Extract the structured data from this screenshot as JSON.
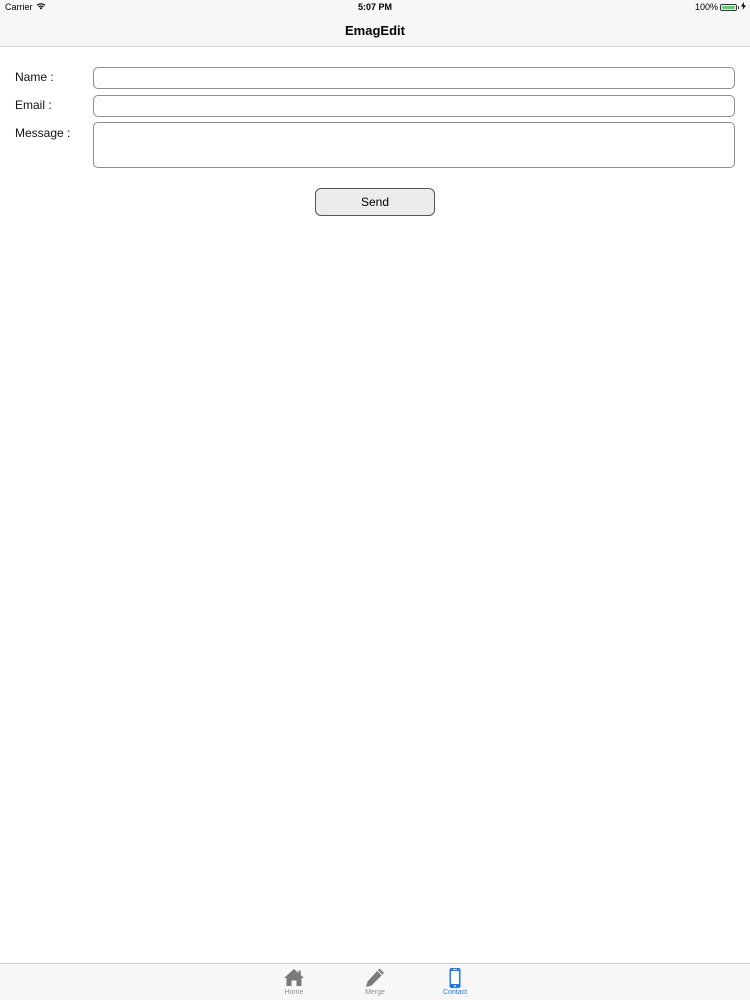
{
  "status_bar": {
    "carrier": "Carrier",
    "time": "5:07 PM",
    "battery": "100%",
    "battery_level": 1.0
  },
  "nav_bar": {
    "title": "EmagEdit"
  },
  "form": {
    "name_label": "Name :",
    "name_value": "",
    "email_label": "Email :",
    "email_value": "",
    "message_label": "Message :",
    "message_value": "",
    "send_label": "Send"
  },
  "tab_bar": {
    "tabs": [
      {
        "label": "Home",
        "icon": "home-icon",
        "active": false
      },
      {
        "label": "Merge",
        "icon": "pencil-icon",
        "active": false
      },
      {
        "label": "Contact",
        "icon": "phone-icon",
        "active": true
      }
    ]
  },
  "colors": {
    "active_tab": "#1a7cf5",
    "inactive_tab": "#8e8e8e",
    "battery": "#4cd964"
  }
}
